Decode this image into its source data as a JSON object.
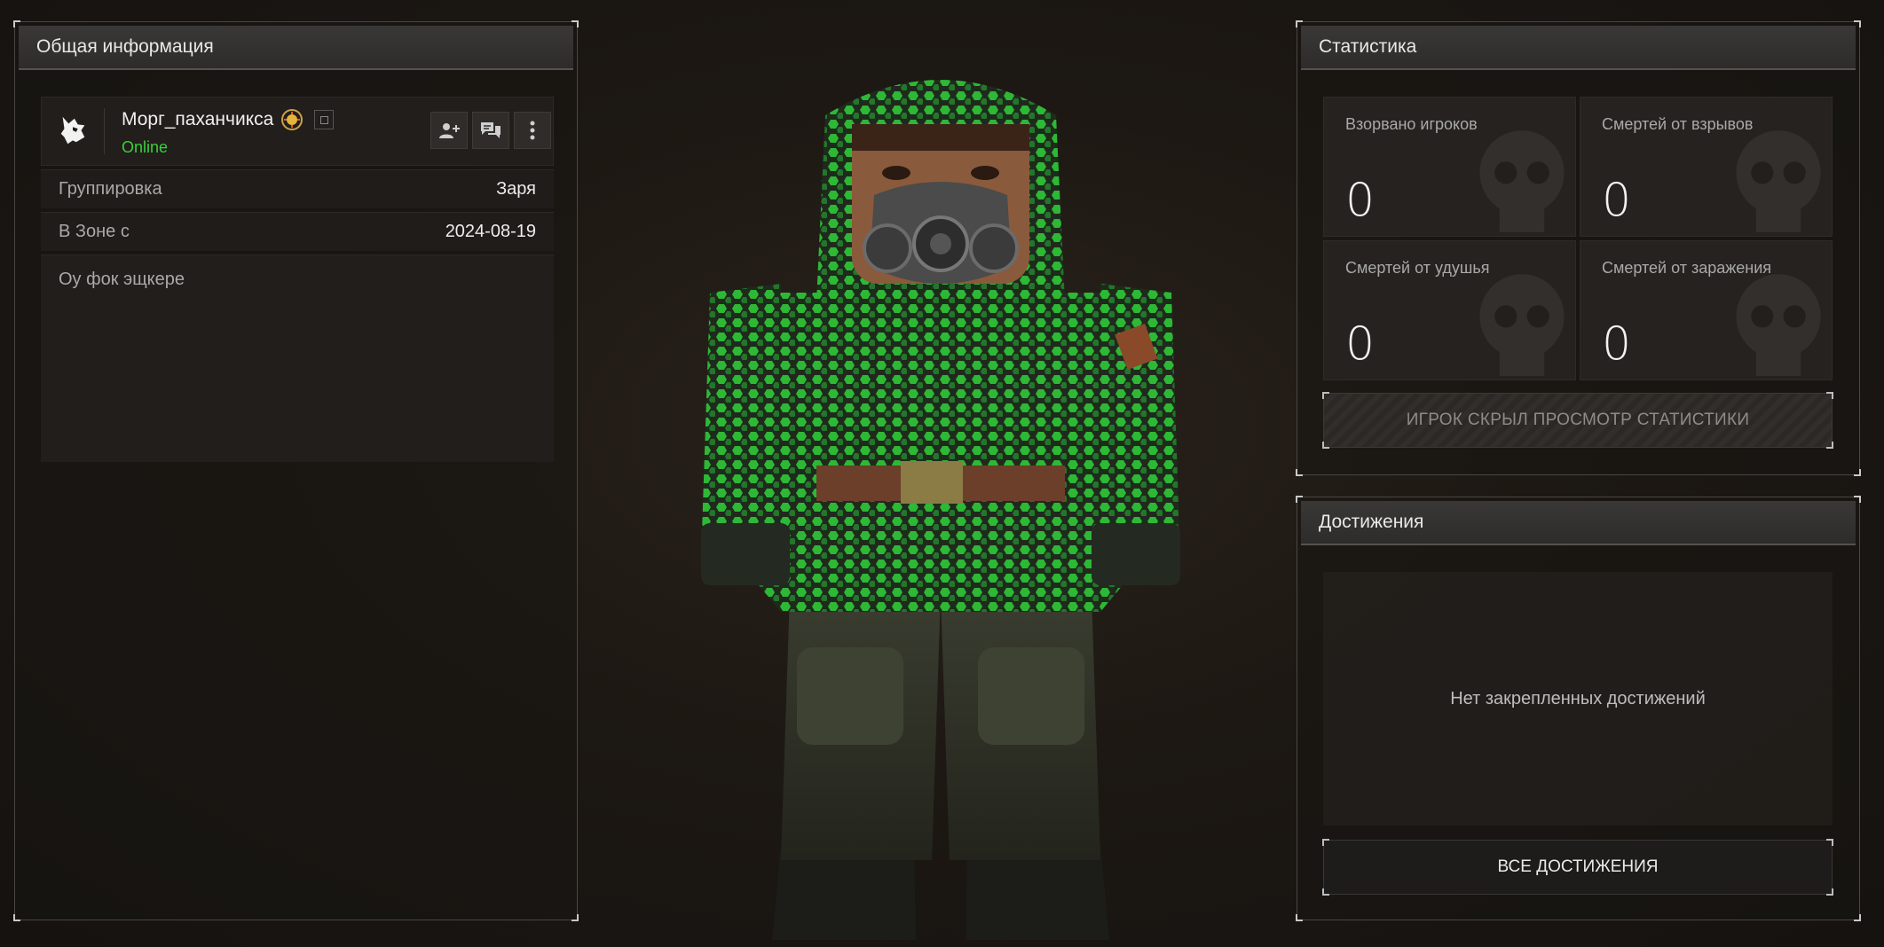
{
  "info_panel": {
    "title": "Общая информация",
    "nickname": "Морг_паханчикса",
    "status": "Online",
    "rows": [
      {
        "label": "Группировка",
        "value": "Заря"
      },
      {
        "label": "В Зоне с",
        "value": "2024-08-19"
      }
    ],
    "bio": "Оу фок эщкере"
  },
  "stats_panel": {
    "title": "Статистика",
    "cells": [
      {
        "label": "Взорвано игроков",
        "value": "0"
      },
      {
        "label": "Смертей от взрывов",
        "value": "0"
      },
      {
        "label": "Смертей от удушья",
        "value": "0"
      },
      {
        "label": "Смертей от заражения",
        "value": "0"
      }
    ],
    "hidden_notice": "ИГРОК СКРЫЛ ПРОСМОТР СТАТИСТИКИ"
  },
  "achievements_panel": {
    "title": "Достижения",
    "empty_text": "Нет закрепленных достижений",
    "all_button": "ВСЕ ДОСТИЖЕНИЯ"
  },
  "icons": {
    "faction": "wolf-head-icon",
    "badge": "sun-badge-icon",
    "copy": "copy-icon",
    "add_friend": "add-friend-icon",
    "message": "chat-icon",
    "more": "more-vertical-icon"
  },
  "colors": {
    "online": "#39d03a",
    "camo_green": "#2fd13a"
  }
}
